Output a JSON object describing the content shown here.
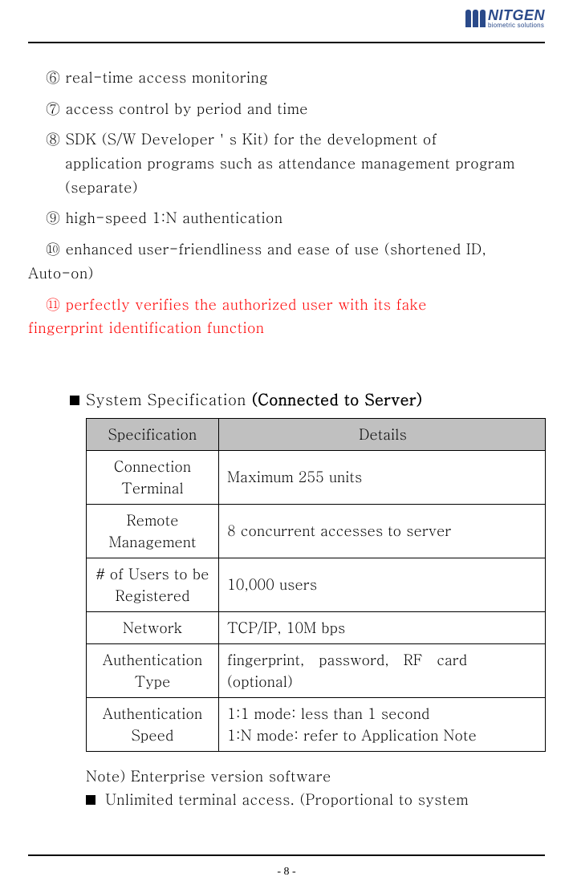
{
  "logo": {
    "main": "NITGEN",
    "sub": "biometric solutions"
  },
  "list": {
    "item6": {
      "num": "⑥",
      "text": "real-time access monitoring"
    },
    "item7": {
      "num": "⑦",
      "text": "access control by period and time"
    },
    "item8": {
      "num": "⑧",
      "line1": "SDK  (S/W  Developer＇s  Kit)  for  the  development  of",
      "line2": "application programs such as attendance management program",
      "line3": "(separate)"
    },
    "item9": {
      "num": "⑨",
      "text": "high-speed 1:N authentication"
    },
    "item10": {
      "num": "⑩",
      "line1": "enhanced user-friendliness and ease of use (shortened ID,",
      "line2": "Auto-on)"
    },
    "item11": {
      "num": "⑪",
      "line1": "perfectly  verifies  the  authorized  user  with  its  fake",
      "line2": "fingerprint identification function"
    }
  },
  "section": {
    "title_plain": "System Specification ",
    "title_bold": "(Connected to Server)"
  },
  "table": {
    "header_spec": "Specification",
    "header_det": "Details",
    "rows": [
      {
        "spec": "Connection\nTerminal",
        "det": "Maximum 255 units"
      },
      {
        "spec": "Remote\nManagement",
        "det": "8 concurrent accesses to server"
      },
      {
        "spec": "# of Users to be\nRegistered",
        "det": "10,000 users"
      },
      {
        "spec": "Network",
        "det": "TCP/IP, 10M bps"
      },
      {
        "spec": "Authentication\nType",
        "det": "fingerprint,   password,   RF   card\n(optional)"
      },
      {
        "spec": "Authentication\nSpeed",
        "det": "1:1 mode: less than 1 second\n1:N mode: refer to Application Note"
      }
    ]
  },
  "note": {
    "line1": "Note) Enterprise version software",
    "line2": "Unlimited  terminal  access.  (Proportional  to  system"
  },
  "page_number": "- 8 -"
}
